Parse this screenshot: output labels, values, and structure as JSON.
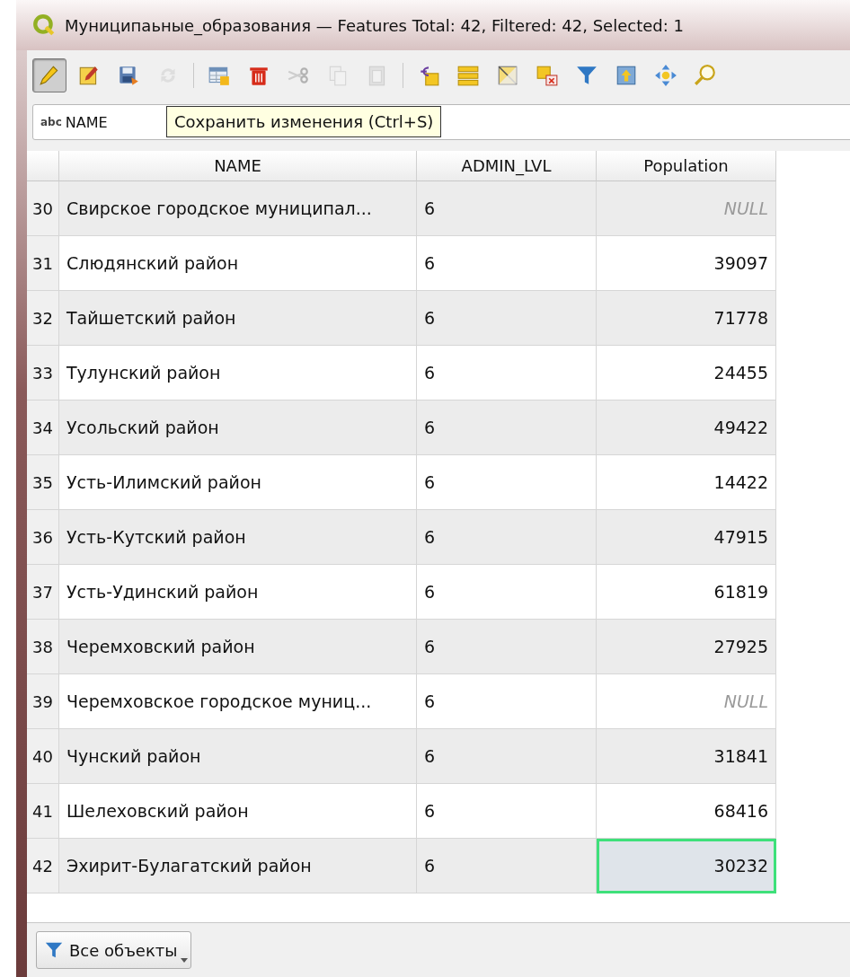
{
  "window": {
    "title": "Муниципаьные_образования — Features Total: 42, Filtered: 42, Selected: 1"
  },
  "edit_toggle": {
    "on": true
  },
  "toolbar": [
    [
      {
        "kind": "notepad",
        "disabled": false
      },
      {
        "kind": "floppy",
        "disabled": false
      },
      {
        "kind": "refresh",
        "disabled": true
      }
    ],
    [
      {
        "kind": "table",
        "disabled": false
      },
      {
        "kind": "trash",
        "disabled": false
      },
      {
        "kind": "scissors",
        "disabled": true
      },
      {
        "kind": "copy",
        "disabled": true
      },
      {
        "kind": "paste",
        "disabled": true
      }
    ],
    [
      {
        "kind": "epsilon",
        "disabled": false
      },
      {
        "kind": "bars",
        "disabled": false
      },
      {
        "kind": "invert",
        "disabled": false
      },
      {
        "kind": "deselect",
        "disabled": false
      },
      {
        "kind": "funnel",
        "disabled": false
      },
      {
        "kind": "totop",
        "disabled": false
      },
      {
        "kind": "pan",
        "disabled": false
      },
      {
        "kind": "zoom",
        "disabled": false
      }
    ]
  ],
  "field_selector": {
    "type_tag": "abc",
    "value": "NAME"
  },
  "tooltip": "Сохранить изменения (Ctrl+S)",
  "table": {
    "columns": [
      "NAME",
      "ADMIN_LVL",
      "Population"
    ],
    "rows": [
      {
        "number": "30",
        "name": "Свирское городское муниципал...",
        "admin_lvl": "6",
        "population": "NULL",
        "population_null": true,
        "selected": false
      },
      {
        "number": "31",
        "name": "Слюдянский район",
        "admin_lvl": "6",
        "population": "39097",
        "population_null": false,
        "selected": false
      },
      {
        "number": "32",
        "name": "Тайшетский район",
        "admin_lvl": "6",
        "population": "71778",
        "population_null": false,
        "selected": false
      },
      {
        "number": "33",
        "name": "Тулунский район",
        "admin_lvl": "6",
        "population": "24455",
        "population_null": false,
        "selected": false
      },
      {
        "number": "34",
        "name": "Усольский район",
        "admin_lvl": "6",
        "population": "49422",
        "population_null": false,
        "selected": false
      },
      {
        "number": "35",
        "name": "Усть-Илимский район",
        "admin_lvl": "6",
        "population": "14422",
        "population_null": false,
        "selected": false
      },
      {
        "number": "36",
        "name": "Усть-Кутский район",
        "admin_lvl": "6",
        "population": "47915",
        "population_null": false,
        "selected": false
      },
      {
        "number": "37",
        "name": "Усть-Удинский район",
        "admin_lvl": "6",
        "population": "61819",
        "population_null": false,
        "selected": false
      },
      {
        "number": "38",
        "name": "Черемховский район",
        "admin_lvl": "6",
        "population": "27925",
        "population_null": false,
        "selected": false
      },
      {
        "number": "39",
        "name": "Черемховское городское муниц...",
        "admin_lvl": "6",
        "population": "NULL",
        "population_null": true,
        "selected": false
      },
      {
        "number": "40",
        "name": "Чунский район",
        "admin_lvl": "6",
        "population": "31841",
        "population_null": false,
        "selected": false
      },
      {
        "number": "41",
        "name": "Шелеховский район",
        "admin_lvl": "6",
        "population": "68416",
        "population_null": false,
        "selected": false
      },
      {
        "number": "42",
        "name": "Эхирит-Булагатский район",
        "admin_lvl": "6",
        "population": "30232",
        "population_null": false,
        "selected": true
      }
    ]
  },
  "filter_button": {
    "label": "Все объекты"
  }
}
